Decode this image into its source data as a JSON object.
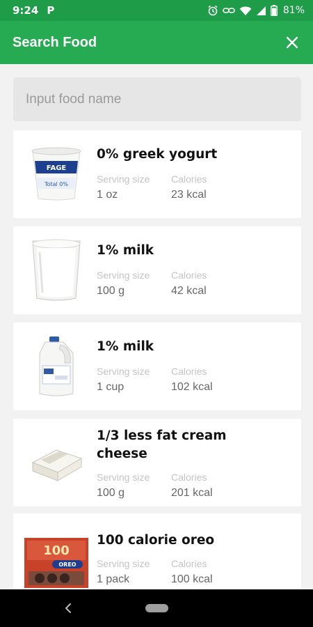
{
  "status_bar": {
    "time": "9:24",
    "app_icon": "P",
    "battery": "81%",
    "icons": [
      "alarm-icon",
      "link-icon",
      "wifi-icon",
      "signal-icon",
      "battery-icon"
    ]
  },
  "app_bar": {
    "title": "Search Food",
    "close_icon": "close-icon",
    "color": "#26ab52"
  },
  "search": {
    "placeholder": "Input food name",
    "value": ""
  },
  "labels": {
    "serving": "Serving size",
    "calories": "Calories"
  },
  "foods": [
    {
      "name": "0% greek yogurt",
      "serving": "1 oz",
      "calories": "23 kcal",
      "image": "yogurt-image"
    },
    {
      "name": "1% milk",
      "serving": "100 g",
      "calories": "42 kcal",
      "image": "milk-glass-image"
    },
    {
      "name": "1% milk",
      "serving": "1 cup",
      "calories": "102 kcal",
      "image": "milk-jug-image"
    },
    {
      "name": "1/3 less fat cream cheese",
      "serving": "100 g",
      "calories": "201 kcal",
      "image": "cream-cheese-image"
    },
    {
      "name": "100 calorie oreo",
      "serving": "1 pack",
      "calories": "100 kcal",
      "image": "oreo-pack-image"
    }
  ]
}
